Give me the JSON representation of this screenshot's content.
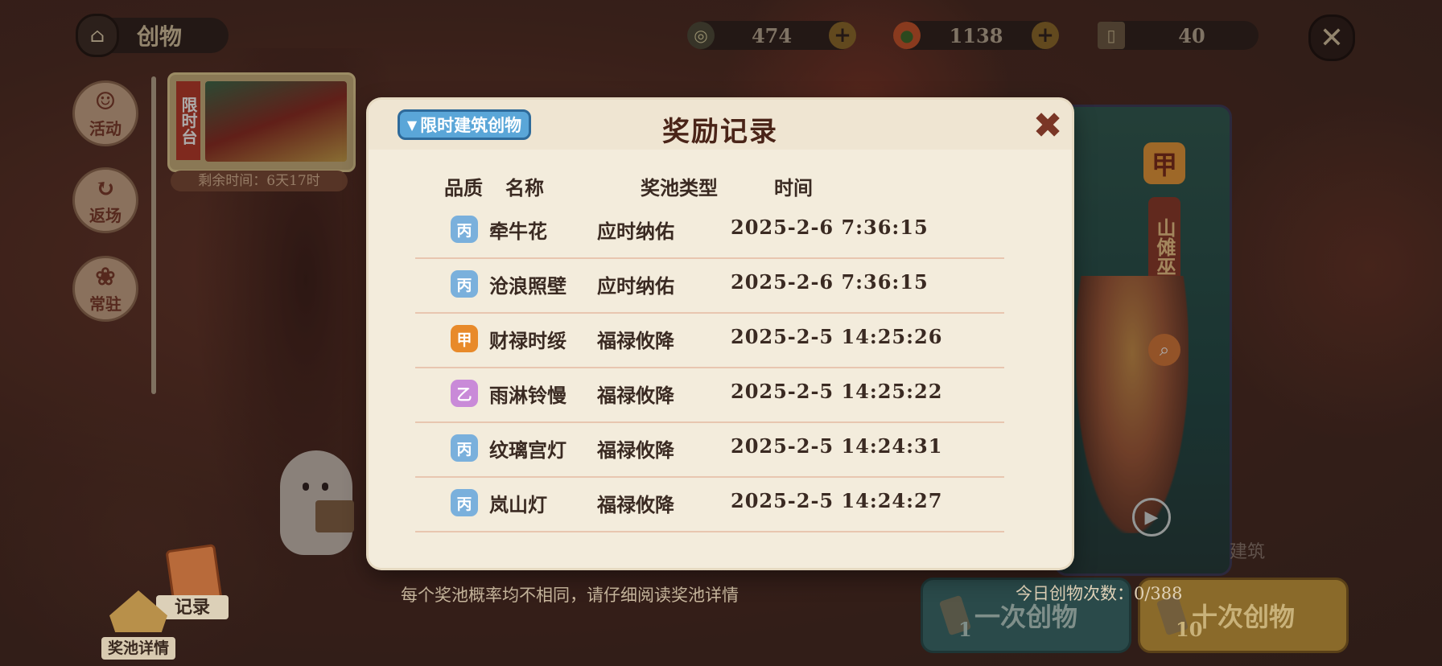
{
  "header": {
    "title": "创物",
    "resources": [
      {
        "icon": "coin-icon",
        "value": "474",
        "has_plus": true
      },
      {
        "icon": "fruit-icon",
        "value": "1138",
        "has_plus": true
      },
      {
        "icon": "scroll-icon",
        "value": "40",
        "has_plus": false
      }
    ]
  },
  "sidebar": {
    "items": [
      {
        "label": "活动",
        "icon": "lion-dance-icon"
      },
      {
        "label": "返场",
        "icon": "return-icon"
      },
      {
        "label": "常驻",
        "icon": "dumpling-icon"
      }
    ]
  },
  "limited_card": {
    "tag": "限时台",
    "remaining": "剩余时间：6天17时"
  },
  "featured": {
    "grade": "甲",
    "name": "山傩巫音",
    "tail_text": "建筑"
  },
  "footer": {
    "hint": "每个奖池概率均不相同，请仔细阅读奖池详情",
    "daily_count": "今日创物次数：0/388",
    "draw_one": {
      "label": "一次创物",
      "cost": "1"
    },
    "draw_ten": {
      "label": "十次创物",
      "cost": "10"
    },
    "record_label": "记录",
    "pool_detail_label": "奖池详情"
  },
  "modal": {
    "title": "奖励记录",
    "filter_label": "限时建筑创物",
    "columns": {
      "quality": "品质",
      "name": "名称",
      "pool": "奖池类型",
      "time": "时间"
    },
    "rows": [
      {
        "grade": "丙",
        "grade_class": "g-bing",
        "name": "牵牛花",
        "pool": "应时纳佑",
        "time": "2025-2-6  7:36:15"
      },
      {
        "grade": "丙",
        "grade_class": "g-bing",
        "name": "沧浪照壁",
        "pool": "应时纳佑",
        "time": "2025-2-6  7:36:15"
      },
      {
        "grade": "甲",
        "grade_class": "g-jia",
        "name": "财禄时绥",
        "pool": "福禄攸降",
        "time": "2025-2-5  14:25:26"
      },
      {
        "grade": "乙",
        "grade_class": "g-yi",
        "name": "雨淋铃慢",
        "pool": "福禄攸降",
        "time": "2025-2-5  14:25:22"
      },
      {
        "grade": "丙",
        "grade_class": "g-bing",
        "name": "纹璃宫灯",
        "pool": "福禄攸降",
        "time": "2025-2-5  14:24:31"
      },
      {
        "grade": "丙",
        "grade_class": "g-bing",
        "name": "岚山灯",
        "pool": "福禄攸降",
        "time": "2025-2-5  14:24:27"
      }
    ]
  },
  "colors": {
    "modal_bg": "#f3ecdc",
    "title_text": "#4a2418",
    "grade_bing": "#7ab0dc",
    "grade_jia": "#e88a2a",
    "grade_yi": "#c98ad8",
    "filter_button": "#5aa6d8"
  }
}
